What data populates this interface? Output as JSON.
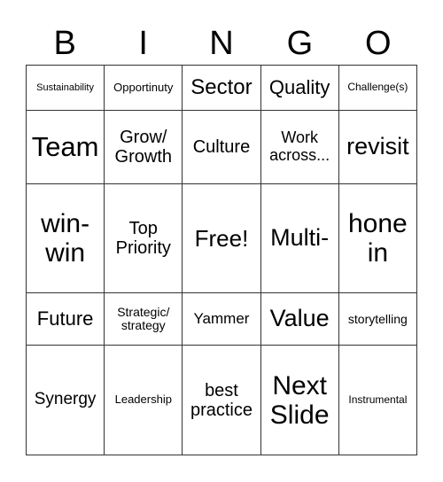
{
  "header": [
    "B",
    "I",
    "N",
    "G",
    "O"
  ],
  "rows": [
    [
      "Sustainability",
      "Opportinuty",
      "Sector",
      "Quality",
      "Challenge(s)"
    ],
    [
      "Team",
      "Grow/ Growth",
      "Culture",
      "Work across...",
      "revisit"
    ],
    [
      "win-win",
      "Top Priority",
      "Free!",
      "Multi-",
      "hone in"
    ],
    [
      "Future",
      "Strategic/ strategy",
      "Yammer",
      "Value",
      "storytelling"
    ],
    [
      "Synergy",
      "Leadership",
      "best practice",
      "Next Slide",
      "Instrumental"
    ]
  ]
}
